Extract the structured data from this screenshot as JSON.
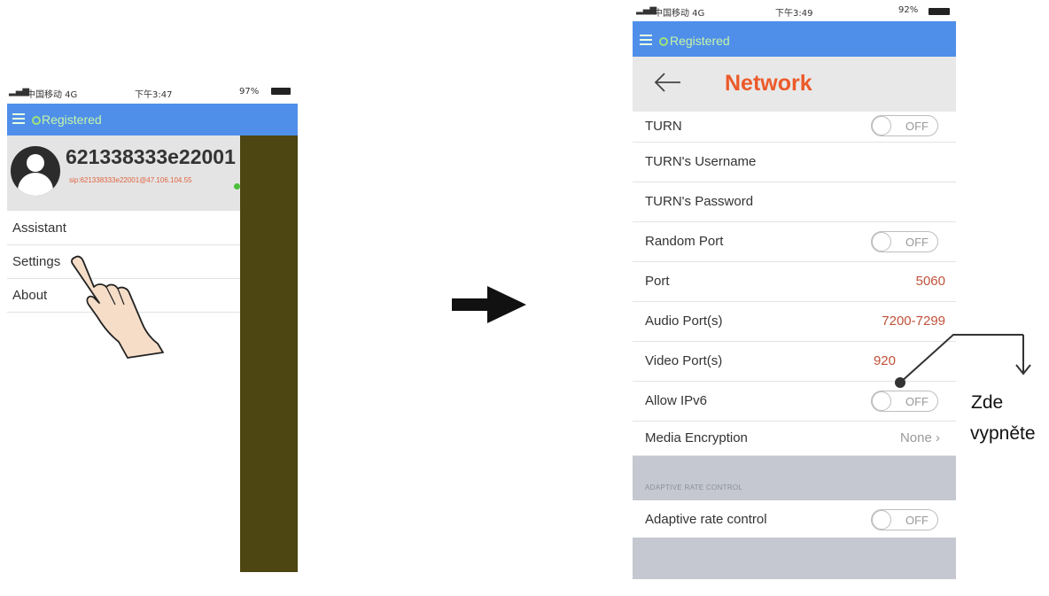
{
  "left_phone": {
    "status": {
      "carrier": "中国移动 4G",
      "time": "下午3:47",
      "battery": "97%"
    },
    "appbar": {
      "status_text": "Registered"
    },
    "profile": {
      "name": "621338333e22001",
      "sip": "sip:621338333e22001@47.106.104.55"
    },
    "menu": [
      {
        "label": "Assistant"
      },
      {
        "label": "Settings"
      },
      {
        "label": "About"
      }
    ]
  },
  "right_phone": {
    "status": {
      "carrier": "中国移动 4G",
      "time": "下午3:49",
      "battery": "92%"
    },
    "appbar": {
      "status_text": "Registered"
    },
    "title": "Network",
    "rows": [
      {
        "label": "TURN",
        "toggle": "OFF"
      },
      {
        "label": "TURN's Username"
      },
      {
        "label": "TURN's Password"
      },
      {
        "label": "Random Port",
        "toggle": "OFF"
      },
      {
        "label": "Port",
        "value": "5060"
      },
      {
        "label": "Audio Port(s)",
        "value": "7200-7299"
      },
      {
        "label": "Video Port(s)",
        "value": "920"
      },
      {
        "label": "Allow IPv6",
        "toggle": "OFF"
      },
      {
        "label": "Media Encryption",
        "value": "None ›"
      }
    ],
    "section_header": "ADAPTIVE RATE CONTROL",
    "adaptive_row": {
      "label": "Adaptive rate control",
      "toggle": "OFF"
    }
  },
  "annotation": {
    "line1": "Zde",
    "line2": "vypněte"
  },
  "icons": [
    "signal-icon",
    "battery-icon",
    "hamburger-icon",
    "registered-dot-icon",
    "avatar-icon",
    "back-arrow-icon",
    "pointing-hand-icon",
    "right-arrow-icon",
    "down-arrow-icon"
  ],
  "colors": {
    "appbar": "#4f8fea",
    "title_orange": "#ec5a2a",
    "drawer_overlay": "#4d4512",
    "value_red": "#c0523a"
  }
}
